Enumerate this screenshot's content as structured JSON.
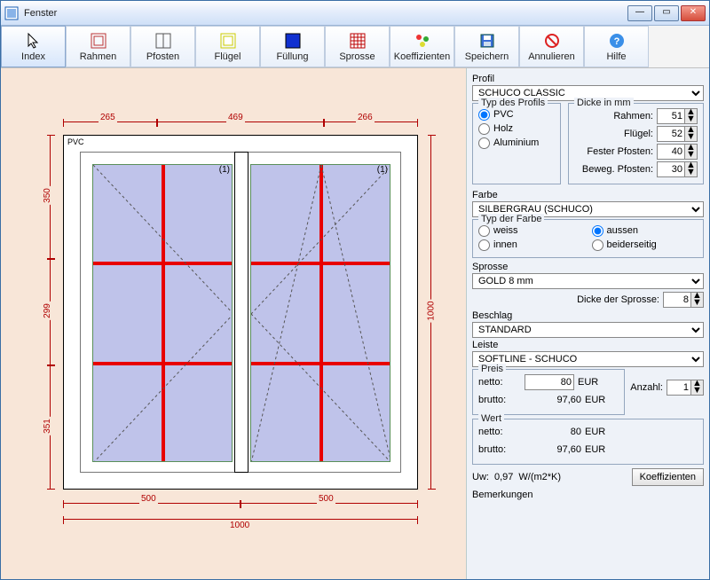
{
  "window_title": "Fenster",
  "toolbar": [
    {
      "id": "index",
      "label": "Index",
      "icon": "cursor"
    },
    {
      "id": "rahmen",
      "label": "Rahmen",
      "icon": "frame"
    },
    {
      "id": "pfosten",
      "label": "Pfosten",
      "icon": "mullion"
    },
    {
      "id": "fluegel",
      "label": "Flügel",
      "icon": "sash"
    },
    {
      "id": "fuellung",
      "label": "Füllung",
      "icon": "fill"
    },
    {
      "id": "sprosse",
      "label": "Sprosse",
      "icon": "grid"
    },
    {
      "id": "koeff",
      "label": "Koeffizienten",
      "icon": "coef"
    },
    {
      "id": "speichern",
      "label": "Speichern",
      "icon": "save"
    },
    {
      "id": "annul",
      "label": "Annulieren",
      "icon": "cancel"
    },
    {
      "id": "hilfe",
      "label": "Hilfe",
      "icon": "help"
    }
  ],
  "toolbar_selected": "index",
  "drawing": {
    "material_tag": "PVC",
    "sash_index_left": "(1)",
    "sash_index_right": "(1)",
    "dims_top": [
      "265",
      "469",
      "266"
    ],
    "dims_bottom": [
      "500",
      "500"
    ],
    "dims_bottom_total": "1000",
    "dims_left": [
      "350",
      "299",
      "351"
    ],
    "dims_right_total": "1000"
  },
  "props": {
    "profil": {
      "label": "Profil",
      "value": "SCHUCO CLASSIC"
    },
    "typ_profil": {
      "legend": "Typ des Profils",
      "options": [
        "PVC",
        "Holz",
        "Aluminium"
      ],
      "selected": "PVC"
    },
    "dicke": {
      "legend": "Dicke in mm",
      "rahmen": {
        "label": "Rahmen:",
        "value": "51"
      },
      "fluegel": {
        "label": "Flügel:",
        "value": "52"
      },
      "fester_pfosten": {
        "label": "Fester Pfosten:",
        "value": "40"
      },
      "beweg_pfosten": {
        "label": "Beweg. Pfosten:",
        "value": "30"
      }
    },
    "farbe": {
      "label": "Farbe",
      "value": "SILBERGRAU (SCHUCO)"
    },
    "typ_farbe": {
      "legend": "Typ der Farbe",
      "left": [
        "weiss",
        "innen"
      ],
      "right": [
        "aussen",
        "beiderseitig"
      ],
      "selected": "aussen"
    },
    "sprosse": {
      "label": "Sprosse",
      "value": "GOLD 8 mm",
      "dicke_label": "Dicke der Sprosse:",
      "dicke_value": "8"
    },
    "beschlag": {
      "label": "Beschlag",
      "value": "STANDARD"
    },
    "leiste": {
      "label": "Leiste",
      "value": "SOFTLINE - SCHUCO"
    },
    "preis": {
      "legend": "Preis",
      "netto_label": "netto:",
      "netto": "80",
      "brutto_label": "brutto:",
      "brutto": "97,60",
      "unit": "EUR"
    },
    "anzahl": {
      "label": "Anzahl:",
      "value": "1"
    },
    "wert": {
      "legend": "Wert",
      "netto_label": "netto:",
      "netto": "80",
      "brutto_label": "brutto:",
      "brutto": "97,60",
      "unit": "EUR"
    },
    "uw": {
      "label": "Uw:",
      "value": "0,97",
      "unit": "W/(m2*K)"
    },
    "koeff_btn": "Koeffizienten",
    "bemerkungen": {
      "label": "Bemerkungen"
    }
  }
}
